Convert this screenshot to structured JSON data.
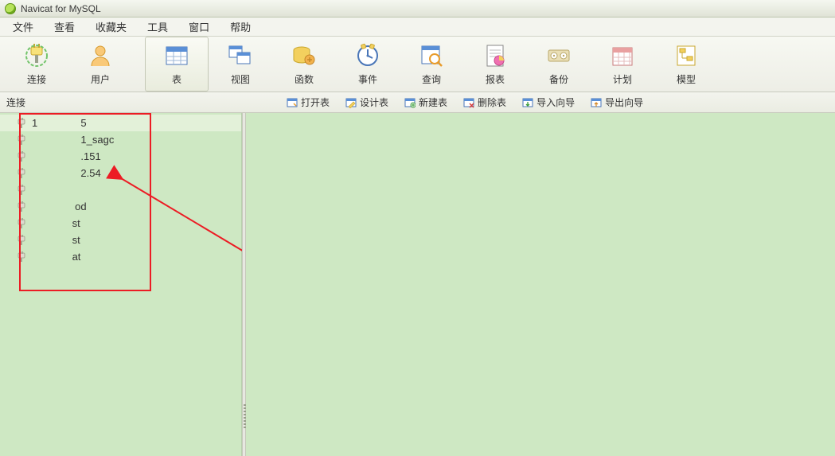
{
  "app": {
    "title": "Navicat for MySQL"
  },
  "menu": {
    "file": "文件",
    "view": "查看",
    "favorites": "收藏夹",
    "tools": "工具",
    "window": "窗口",
    "help": "帮助"
  },
  "toolbar": {
    "connect": "连接",
    "user": "用户",
    "table": "表",
    "view": "视图",
    "function": "函数",
    "event": "事件",
    "query": "查询",
    "report": "报表",
    "backup": "备份",
    "schedule": "计划",
    "model": "模型"
  },
  "subtoolbar": {
    "left_label": "连接",
    "open_table": "打开表",
    "design_table": "设计表",
    "new_table": "新建表",
    "delete_table": "删除表",
    "import_wizard": "导入向导",
    "export_wizard": "导出向导"
  },
  "sidebar": {
    "items": [
      {
        "label": "1               5",
        "selected": true
      },
      {
        "label": "                 1_sagc",
        "selected": false
      },
      {
        "label": "                 .151",
        "selected": false
      },
      {
        "label": "                 2.54",
        "selected": false
      },
      {
        "label": " ",
        "selected": false
      },
      {
        "label": "               od",
        "selected": false
      },
      {
        "label": "              st",
        "selected": false
      },
      {
        "label": "              st",
        "selected": false
      },
      {
        "label": "              at",
        "selected": false
      }
    ]
  }
}
